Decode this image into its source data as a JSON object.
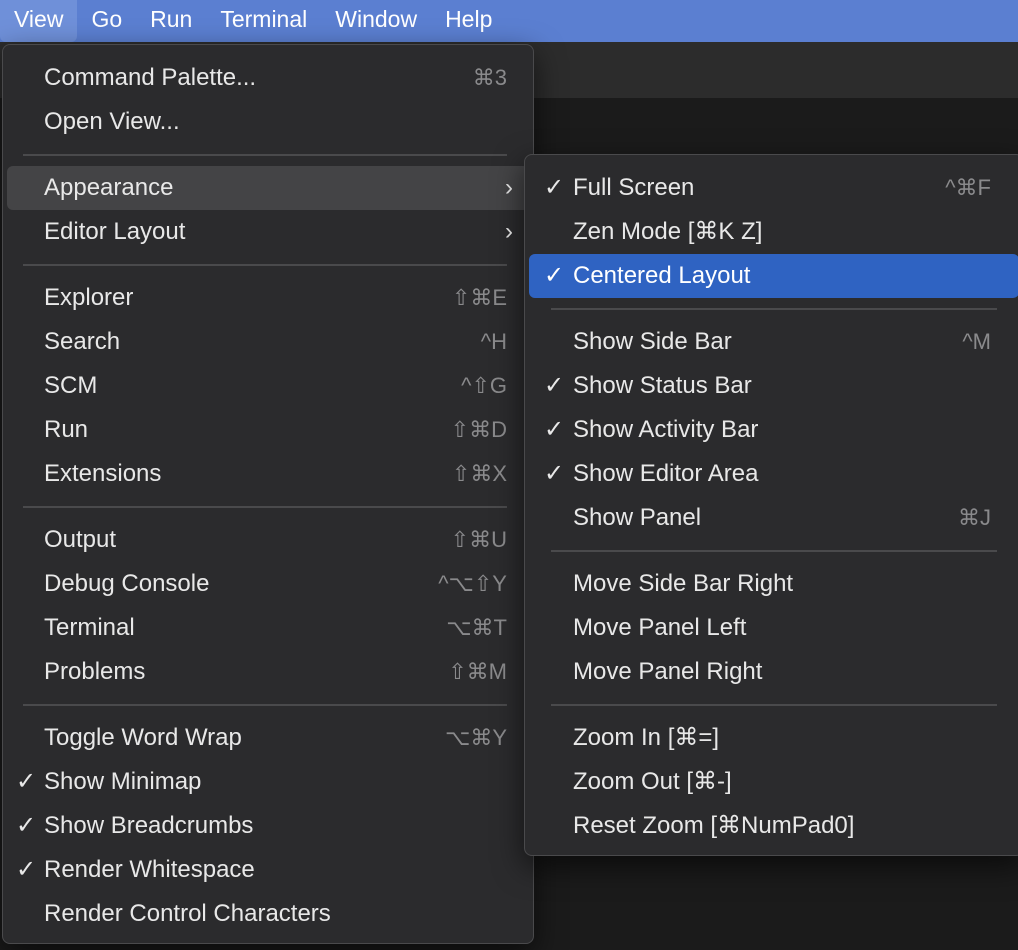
{
  "menubar": {
    "items": [
      "View",
      "Go",
      "Run",
      "Terminal",
      "Window",
      "Help"
    ]
  },
  "view_menu": {
    "items": [
      {
        "label": "Command Palette...",
        "shortcut": "⌘3",
        "check": ""
      },
      {
        "label": "Open View...",
        "shortcut": "",
        "check": ""
      },
      {
        "label": "Appearance",
        "shortcut": "",
        "check": "",
        "submenu": "›"
      },
      {
        "label": "Editor Layout",
        "shortcut": "",
        "check": "",
        "submenu": "›"
      },
      {
        "label": "Explorer",
        "shortcut": "⇧⌘E",
        "check": ""
      },
      {
        "label": "Search",
        "shortcut": "^H",
        "check": ""
      },
      {
        "label": "SCM",
        "shortcut": "^⇧G",
        "check": ""
      },
      {
        "label": "Run",
        "shortcut": "⇧⌘D",
        "check": ""
      },
      {
        "label": "Extensions",
        "shortcut": "⇧⌘X",
        "check": ""
      },
      {
        "label": "Output",
        "shortcut": "⇧⌘U",
        "check": ""
      },
      {
        "label": "Debug Console",
        "shortcut": "^⌥⇧Y",
        "check": ""
      },
      {
        "label": "Terminal",
        "shortcut": "⌥⌘T",
        "check": ""
      },
      {
        "label": "Problems",
        "shortcut": "⇧⌘M",
        "check": ""
      },
      {
        "label": "Toggle Word Wrap",
        "shortcut": "⌥⌘Y",
        "check": ""
      },
      {
        "label": "Show Minimap",
        "shortcut": "",
        "check": "✓"
      },
      {
        "label": "Show Breadcrumbs",
        "shortcut": "",
        "check": "✓"
      },
      {
        "label": "Render Whitespace",
        "shortcut": "",
        "check": "✓"
      },
      {
        "label": "Render Control Characters",
        "shortcut": "",
        "check": ""
      }
    ]
  },
  "appearance_menu": {
    "items": [
      {
        "label": "Full Screen",
        "shortcut": "^⌘F",
        "check": "✓"
      },
      {
        "label": "Zen Mode [⌘K Z]",
        "shortcut": "",
        "check": ""
      },
      {
        "label": "Centered Layout",
        "shortcut": "",
        "check": "✓"
      },
      {
        "label": "Show Side Bar",
        "shortcut": "^M",
        "check": ""
      },
      {
        "label": "Show Status Bar",
        "shortcut": "",
        "check": "✓"
      },
      {
        "label": "Show Activity Bar",
        "shortcut": "",
        "check": "✓"
      },
      {
        "label": "Show Editor Area",
        "shortcut": "",
        "check": "✓"
      },
      {
        "label": "Show Panel",
        "shortcut": "⌘J",
        "check": ""
      },
      {
        "label": "Move Side Bar Right",
        "shortcut": "",
        "check": ""
      },
      {
        "label": "Move Panel Left",
        "shortcut": "",
        "check": ""
      },
      {
        "label": "Move Panel Right",
        "shortcut": "",
        "check": ""
      },
      {
        "label": "Zoom In [⌘=]",
        "shortcut": "",
        "check": ""
      },
      {
        "label": "Zoom Out [⌘-]",
        "shortcut": "",
        "check": ""
      },
      {
        "label": "Reset Zoom [⌘NumPad0]",
        "shortcut": "",
        "check": ""
      }
    ]
  },
  "colors": {
    "menubar": "#5b7fd1",
    "menu_bg": "#2b2b2d",
    "selected": "#2f63c2",
    "hover": "#444446"
  }
}
